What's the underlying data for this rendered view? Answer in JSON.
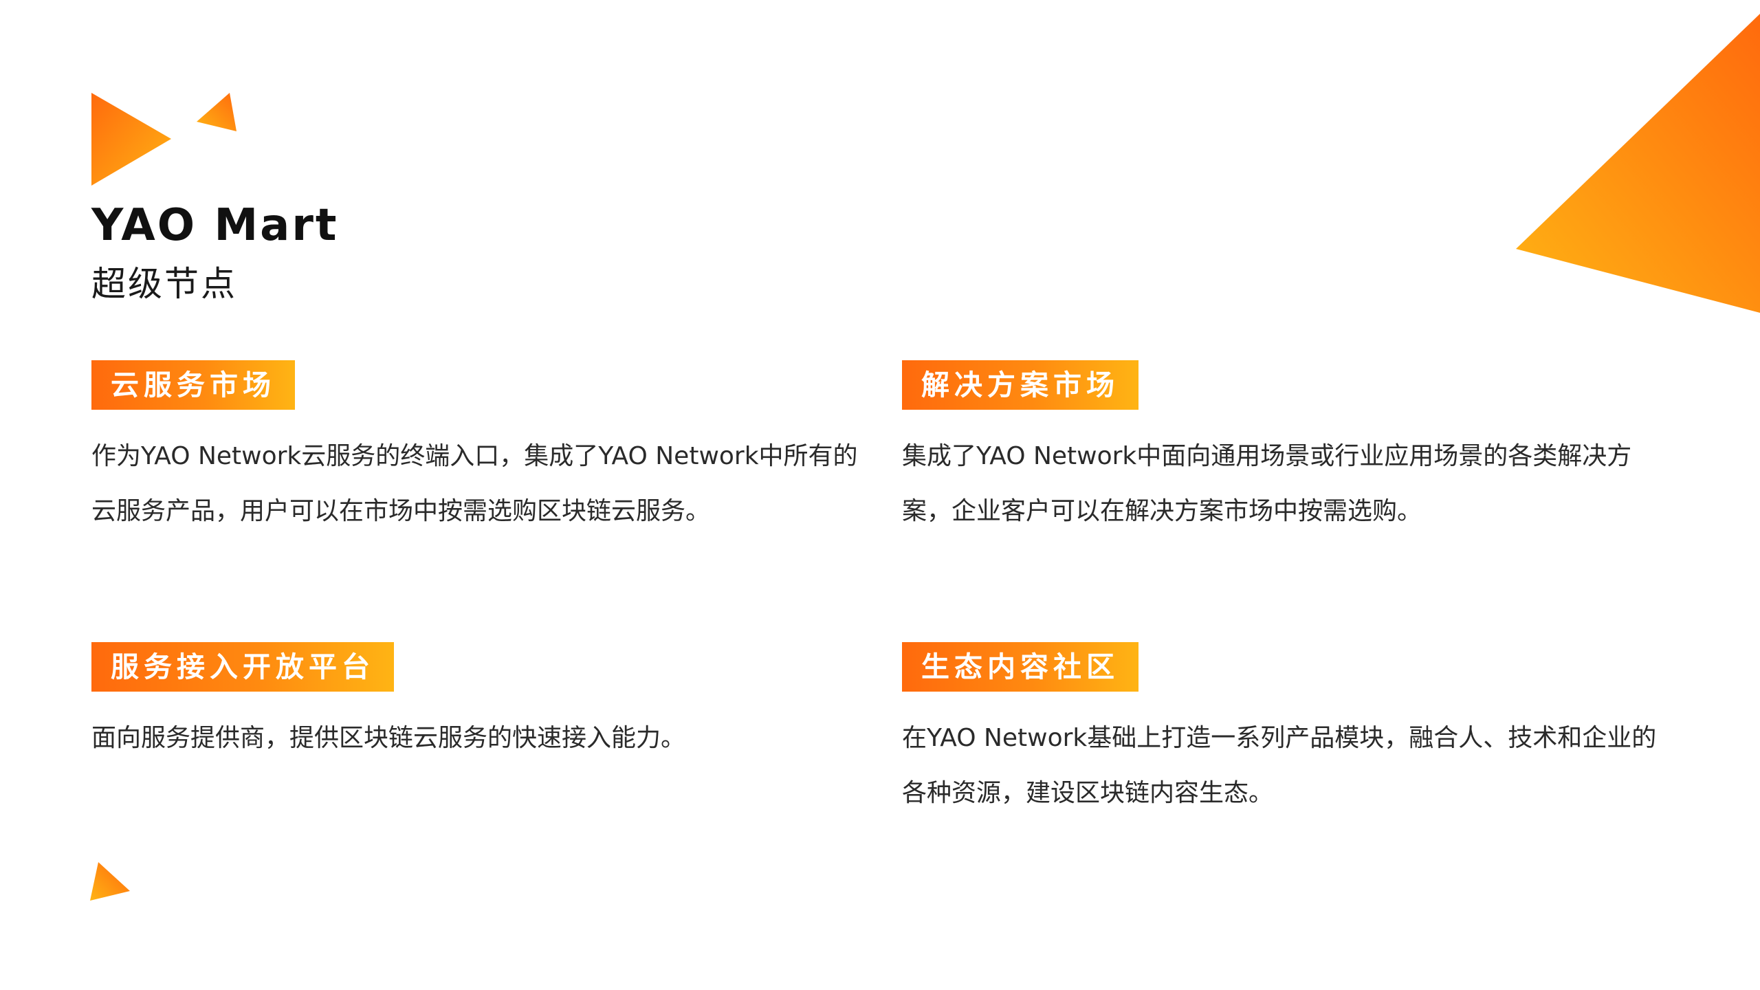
{
  "header": {
    "title": "YAO Mart",
    "subtitle": "超级节点"
  },
  "sections": [
    {
      "tag": "云服务市场",
      "description": "作为YAO Network云服务的终端入口，集成了YAO Network中所有的云服务产品，用户可以在市场中按需选购区块链云服务。"
    },
    {
      "tag": "解决方案市场",
      "description": "集成了YAO Network中面向通用场景或行业应用场景的各类解决方案，企业客户可以在解决方案市场中按需选购。"
    },
    {
      "tag": "服务接入开放平台",
      "description": "面向服务提供商，提供区块链云服务的快速接入能力。"
    },
    {
      "tag": "生态内容社区",
      "description": "在YAO Network基础上打造一系列产品模块，融合人、技术和企业的各种资源，建设区块链内容生态。"
    }
  ],
  "theme": {
    "accent_start": "#ff6a0d",
    "accent_end": "#ffb414",
    "title_color": "#111111",
    "text_color": "#2a2a2a"
  },
  "icons": [
    "play-triangle-logo-icon",
    "small-triangle-icon",
    "corner-triangle-decoration",
    "bottom-triangle-icon"
  ]
}
